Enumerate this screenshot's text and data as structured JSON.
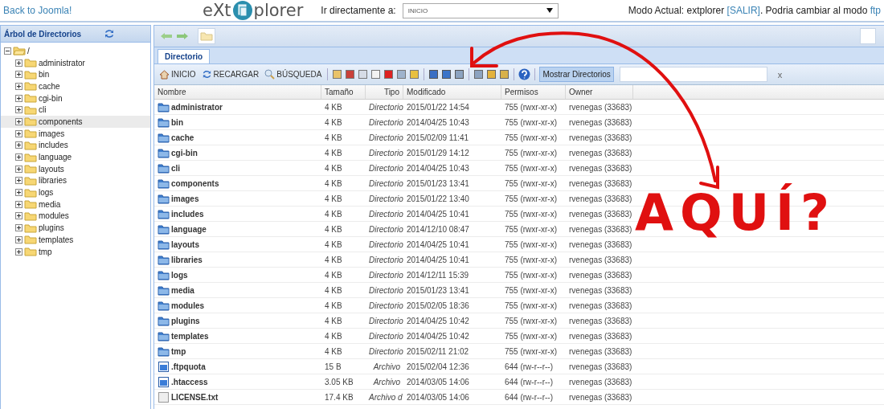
{
  "header": {
    "back_link": "Back to Joomla!",
    "logo_left": "eXt",
    "logo_right": "plorer",
    "goto_label": "Ir directamente a:",
    "goto_value": "INICIO",
    "mode_text": "Modo Actual: extplorer",
    "logout_link": "[SALIR]",
    "mode_suffix": ". Podria cambiar al modo",
    "ftp_link": "ftp"
  },
  "sidebar": {
    "title": "Árbol de Directorios",
    "tree": {
      "label": "/",
      "expanded": true,
      "selected": false,
      "children": [
        {
          "label": "administrator",
          "expanded": false,
          "selected": false
        },
        {
          "label": "bin",
          "expanded": false,
          "selected": false
        },
        {
          "label": "cache",
          "expanded": false,
          "selected": false
        },
        {
          "label": "cgi-bin",
          "expanded": false,
          "selected": false
        },
        {
          "label": "cli",
          "expanded": false,
          "selected": false
        },
        {
          "label": "components",
          "expanded": false,
          "selected": true
        },
        {
          "label": "images",
          "expanded": false,
          "selected": false
        },
        {
          "label": "includes",
          "expanded": false,
          "selected": false
        },
        {
          "label": "language",
          "expanded": false,
          "selected": false
        },
        {
          "label": "layouts",
          "expanded": false,
          "selected": false
        },
        {
          "label": "libraries",
          "expanded": false,
          "selected": false
        },
        {
          "label": "logs",
          "expanded": false,
          "selected": false
        },
        {
          "label": "media",
          "expanded": false,
          "selected": false
        },
        {
          "label": "modules",
          "expanded": false,
          "selected": false
        },
        {
          "label": "plugins",
          "expanded": false,
          "selected": false
        },
        {
          "label": "templates",
          "expanded": false,
          "selected": false
        },
        {
          "label": "tmp",
          "expanded": false,
          "selected": false
        }
      ]
    }
  },
  "tabs": [
    {
      "label": "Directorio",
      "selected": true
    }
  ],
  "toolbar": {
    "buttons": [
      {
        "label": "INICIO",
        "kind": "home"
      },
      {
        "label": "RECARGAR",
        "kind": "reload"
      },
      {
        "label": "BÚSQUEDA",
        "kind": "search"
      }
    ],
    "toggle": {
      "label": "Mostrar Directorios",
      "on": true
    },
    "clear": "x"
  },
  "table": {
    "columns": [
      "Nombre",
      "Tamaño",
      "Tipo",
      "Modificado",
      "Permisos",
      "Owner"
    ],
    "rows": [
      {
        "kind": "dir",
        "name": "administrator",
        "size": "4 KB",
        "type": "Directorio",
        "modified": "2015/01/22 14:54",
        "perms": "755 (rwxr-xr-x)",
        "owner": "rvenegas (33683)"
      },
      {
        "kind": "dir",
        "name": "bin",
        "size": "4 KB",
        "type": "Directorio",
        "modified": "2014/04/25 10:43",
        "perms": "755 (rwxr-xr-x)",
        "owner": "rvenegas (33683)"
      },
      {
        "kind": "dir",
        "name": "cache",
        "size": "4 KB",
        "type": "Directorio",
        "modified": "2015/02/09 11:41",
        "perms": "755 (rwxr-xr-x)",
        "owner": "rvenegas (33683)"
      },
      {
        "kind": "dir",
        "name": "cgi-bin",
        "size": "4 KB",
        "type": "Directorio",
        "modified": "2015/01/29 14:12",
        "perms": "755 (rwxr-xr-x)",
        "owner": "rvenegas (33683)"
      },
      {
        "kind": "dir",
        "name": "cli",
        "size": "4 KB",
        "type": "Directorio",
        "modified": "2014/04/25 10:43",
        "perms": "755 (rwxr-xr-x)",
        "owner": "rvenegas (33683)"
      },
      {
        "kind": "dir",
        "name": "components",
        "size": "4 KB",
        "type": "Directorio",
        "modified": "2015/01/23 13:41",
        "perms": "755 (rwxr-xr-x)",
        "owner": "rvenegas (33683)"
      },
      {
        "kind": "dir",
        "name": "images",
        "size": "4 KB",
        "type": "Directorio",
        "modified": "2015/01/22 13:40",
        "perms": "755 (rwxr-xr-x)",
        "owner": "rvenegas (33683)"
      },
      {
        "kind": "dir",
        "name": "includes",
        "size": "4 KB",
        "type": "Directorio",
        "modified": "2014/04/25 10:41",
        "perms": "755 (rwxr-xr-x)",
        "owner": "rvenegas (33683)"
      },
      {
        "kind": "dir",
        "name": "language",
        "size": "4 KB",
        "type": "Directorio",
        "modified": "2014/12/10 08:47",
        "perms": "755 (rwxr-xr-x)",
        "owner": "rvenegas (33683)"
      },
      {
        "kind": "dir",
        "name": "layouts",
        "size": "4 KB",
        "type": "Directorio",
        "modified": "2014/04/25 10:41",
        "perms": "755 (rwxr-xr-x)",
        "owner": "rvenegas (33683)"
      },
      {
        "kind": "dir",
        "name": "libraries",
        "size": "4 KB",
        "type": "Directorio",
        "modified": "2014/04/25 10:41",
        "perms": "755 (rwxr-xr-x)",
        "owner": "rvenegas (33683)"
      },
      {
        "kind": "dir",
        "name": "logs",
        "size": "4 KB",
        "type": "Directorio",
        "modified": "2014/12/11 15:39",
        "perms": "755 (rwxr-xr-x)",
        "owner": "rvenegas (33683)"
      },
      {
        "kind": "dir",
        "name": "media",
        "size": "4 KB",
        "type": "Directorio",
        "modified": "2015/01/23 13:41",
        "perms": "755 (rwxr-xr-x)",
        "owner": "rvenegas (33683)"
      },
      {
        "kind": "dir",
        "name": "modules",
        "size": "4 KB",
        "type": "Directorio",
        "modified": "2015/02/05 18:36",
        "perms": "755 (rwxr-xr-x)",
        "owner": "rvenegas (33683)"
      },
      {
        "kind": "dir",
        "name": "plugins",
        "size": "4 KB",
        "type": "Directorio",
        "modified": "2014/04/25 10:42",
        "perms": "755 (rwxr-xr-x)",
        "owner": "rvenegas (33683)"
      },
      {
        "kind": "dir",
        "name": "templates",
        "size": "4 KB",
        "type": "Directorio",
        "modified": "2014/04/25 10:42",
        "perms": "755 (rwxr-xr-x)",
        "owner": "rvenegas (33683)"
      },
      {
        "kind": "dir",
        "name": "tmp",
        "size": "4 KB",
        "type": "Directorio",
        "modified": "2015/02/11 21:02",
        "perms": "755 (rwxr-xr-x)",
        "owner": "rvenegas (33683)"
      },
      {
        "kind": "file",
        "name": ".ftpquota",
        "size": "15 B",
        "type": "Archivo",
        "modified": "2015/02/04 12:36",
        "perms": "644 (rw-r--r--)",
        "owner": "rvenegas (33683)"
      },
      {
        "kind": "file",
        "name": ".htaccess",
        "size": "3.05 KB",
        "type": "Archivo",
        "modified": "2014/03/05 14:06",
        "perms": "644 (rw-r--r--)",
        "owner": "rvenegas (33683)"
      },
      {
        "kind": "text",
        "name": "LICENSE.txt",
        "size": "17.4 KB",
        "type": "Archivo d",
        "modified": "2014/03/05 14:06",
        "perms": "644 (rw-r--r--)",
        "owner": "rvenegas (33683)"
      }
    ]
  },
  "annotation": {
    "text": "AQUÍ?"
  }
}
